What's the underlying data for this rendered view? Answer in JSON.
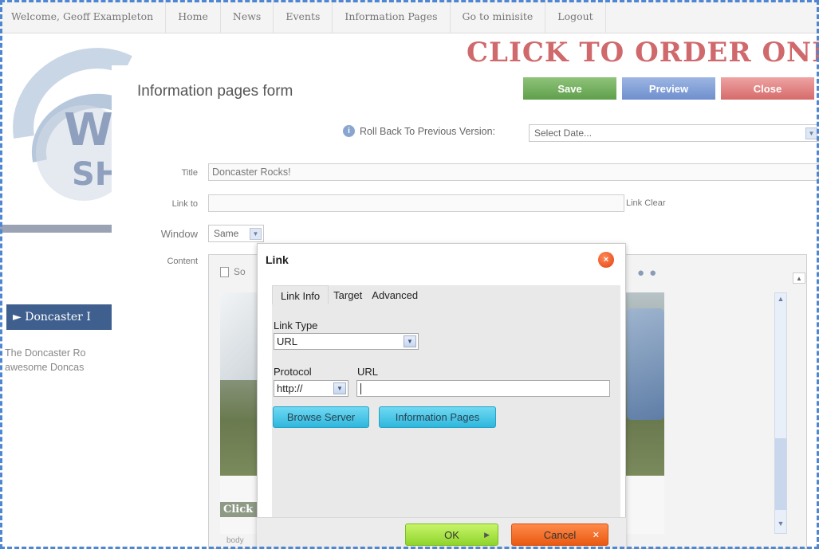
{
  "nav": {
    "welcome": "Welcome, Geoff Exampleton",
    "items": [
      "Home",
      "News",
      "Events",
      "Information Pages",
      "Go to minisite",
      "Logout"
    ]
  },
  "background": {
    "banner_text": "CLICK TO ORDER ONLINE",
    "side_link": "► Doncaster I",
    "side_text_1": "The Doncaster Ro",
    "side_text_2": "awesome Doncas"
  },
  "form": {
    "title": "Information pages form",
    "buttons": {
      "save": "Save",
      "preview": "Preview",
      "close": "Close"
    },
    "rollback_label": "Roll Back To Previous Version:",
    "rollback_value": "Select Date...",
    "title_label": "Title",
    "title_value": "Doncaster Rocks!",
    "link_to_label": "Link to",
    "link_to_value": "",
    "link_clear": "Link Clear",
    "window_label": "Window",
    "window_value": "Same",
    "content_label": "Content",
    "editor_toolbar_fragment": "So",
    "editor_image_caption": "Click I",
    "editor_path": "body"
  },
  "dialog": {
    "title": "Link",
    "tabs": [
      "Link Info",
      "Target",
      "Advanced"
    ],
    "link_type_label": "Link Type",
    "link_type_value": "URL",
    "protocol_label": "Protocol",
    "protocol_value": "http://",
    "url_label": "URL",
    "url_value": "",
    "browse_server": "Browse Server",
    "information_pages": "Information Pages",
    "ok": "OK",
    "cancel": "Cancel"
  },
  "colors": {
    "frame": "#4f86d2",
    "save": "#6aaa55",
    "preview": "#7b98d2",
    "close": "#dc7b7b",
    "ok": "#9ad93a",
    "cancel": "#f06a1f",
    "cyan": "#3cc1e6"
  }
}
